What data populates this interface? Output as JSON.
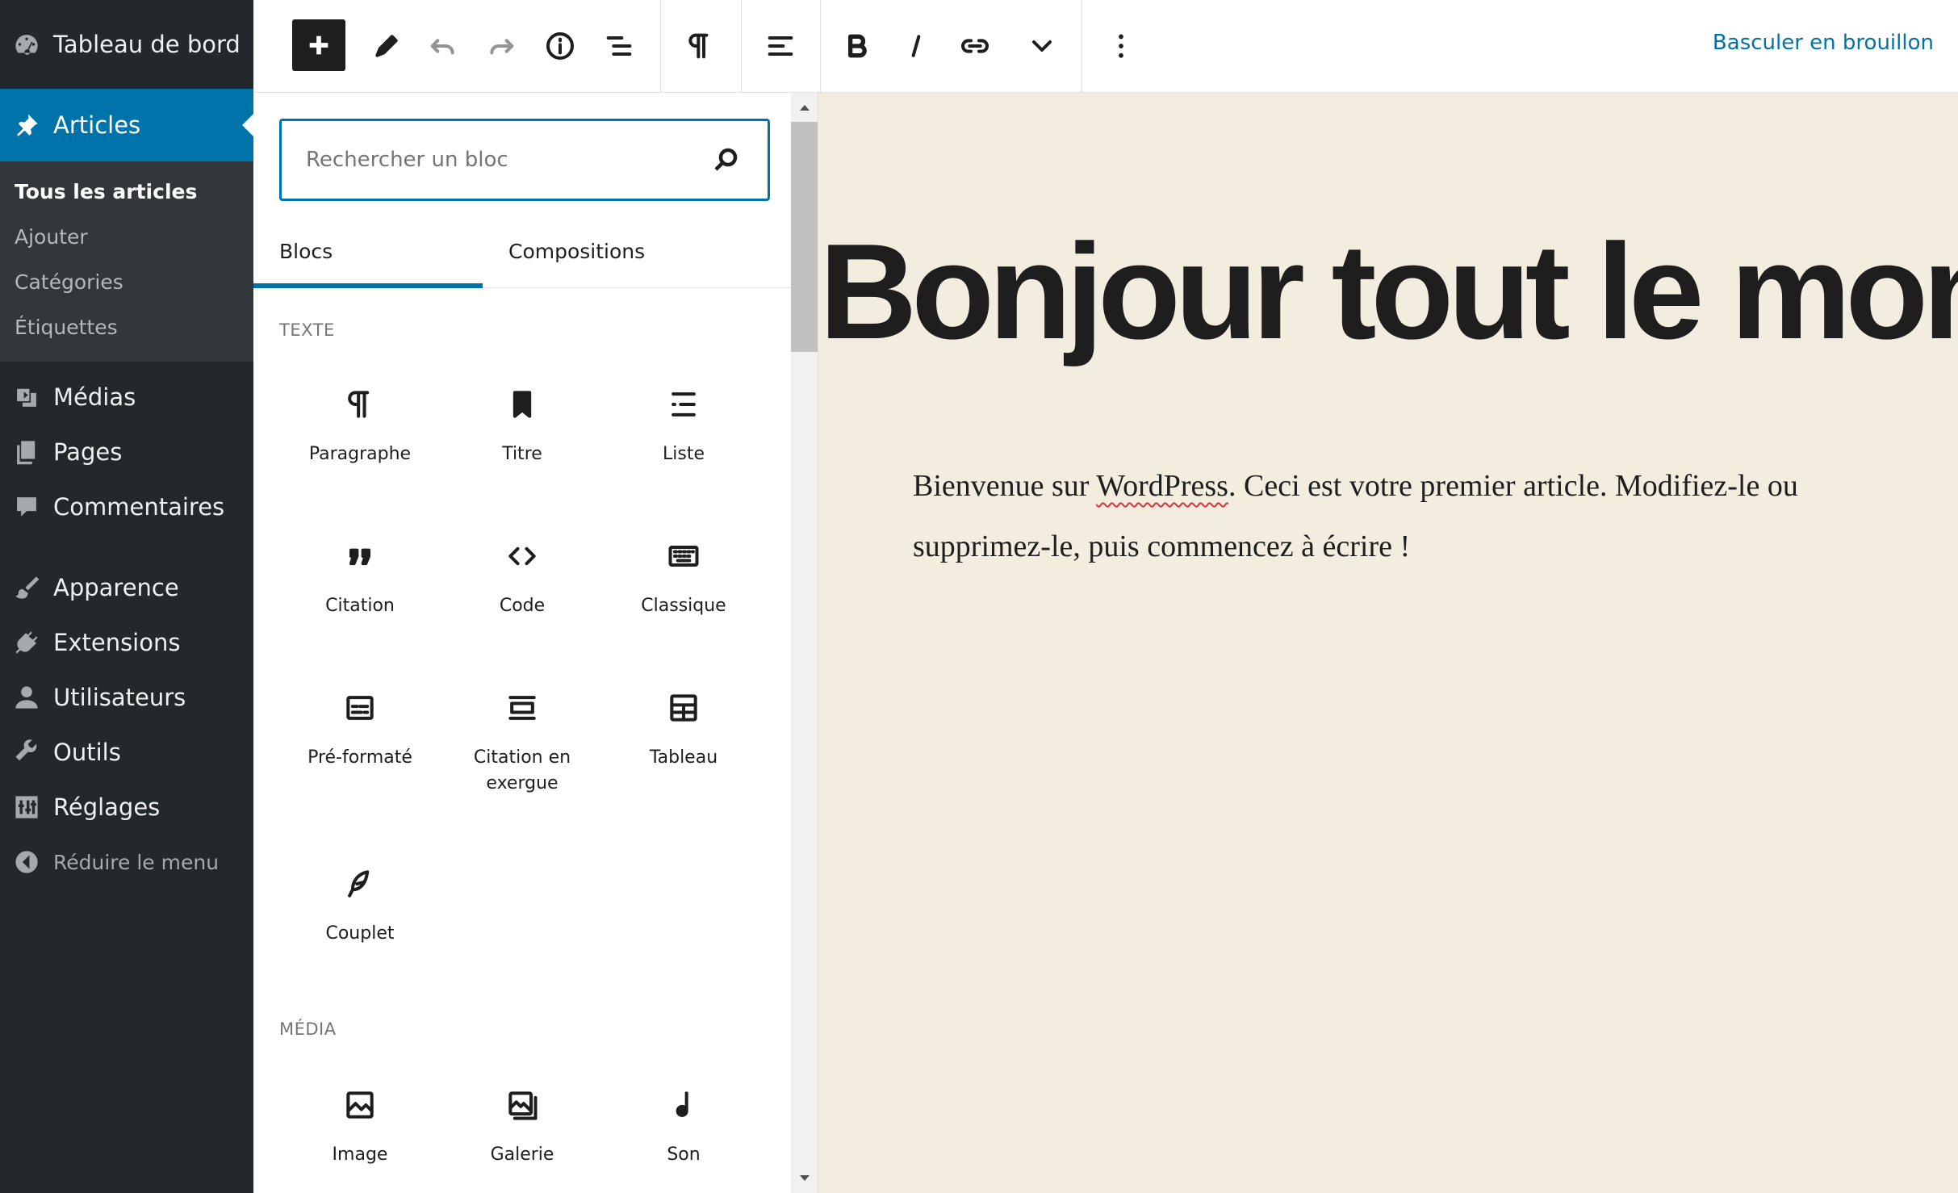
{
  "admin_menu": {
    "dashboard": "Tableau de bord",
    "articles": "Articles",
    "articles_sub": [
      "Tous les articles",
      "Ajouter",
      "Catégories",
      "Étiquettes"
    ],
    "medias": "Médias",
    "pages": "Pages",
    "comments": "Commentaires",
    "appearance": "Apparence",
    "plugins": "Extensions",
    "users": "Utilisateurs",
    "tools": "Outils",
    "settings": "Réglages",
    "collapse": "Réduire le menu"
  },
  "toolbar": {
    "draft_link": "Basculer en brouillon",
    "icons": [
      "plus-icon",
      "pen-icon",
      "undo-icon",
      "redo-icon",
      "info-icon",
      "list-view-icon",
      "paragraph-icon",
      "align-icon",
      "bold-icon",
      "italic-icon",
      "link-icon",
      "chevron-down-icon",
      "more-options-icon"
    ]
  },
  "inserter": {
    "search_placeholder": "Rechercher un bloc",
    "tabs": [
      "Blocs",
      "Compositions"
    ],
    "sections": {
      "text": "TEXTE",
      "media": "MÉDIA"
    },
    "text_blocks": [
      {
        "label": "Paragraphe",
        "icon": "paragraph-icon"
      },
      {
        "label": "Titre",
        "icon": "bookmark-icon"
      },
      {
        "label": "Liste",
        "icon": "list-icon"
      },
      {
        "label": "Citation",
        "icon": "quote-icon"
      },
      {
        "label": "Code",
        "icon": "code-icon"
      },
      {
        "label": "Classique",
        "icon": "keyboard-icon"
      },
      {
        "label": "Pré-formaté",
        "icon": "preformatted-icon"
      },
      {
        "label": "Citation en exergue",
        "icon": "pullquote-icon"
      },
      {
        "label": "Tableau",
        "icon": "table-icon"
      },
      {
        "label": "Couplet",
        "icon": "feather-icon"
      }
    ],
    "media_blocks": [
      {
        "label": "Image",
        "icon": "image-icon"
      },
      {
        "label": "Galerie",
        "icon": "gallery-icon"
      },
      {
        "label": "Son",
        "icon": "audio-icon"
      }
    ]
  },
  "post": {
    "title": "Bonjour tout le monde !",
    "body_before": "Bienvenue sur ",
    "body_link": "WordPress",
    "body_after": ". Ceci est votre premier article. Modifiez-le ou supprimez-le, puis commencez à écrire !"
  },
  "colors": {
    "admin_bg": "#23282d",
    "admin_active": "#0073aa",
    "canvas_bg": "#f3ede0",
    "accent": "#0073aa"
  }
}
